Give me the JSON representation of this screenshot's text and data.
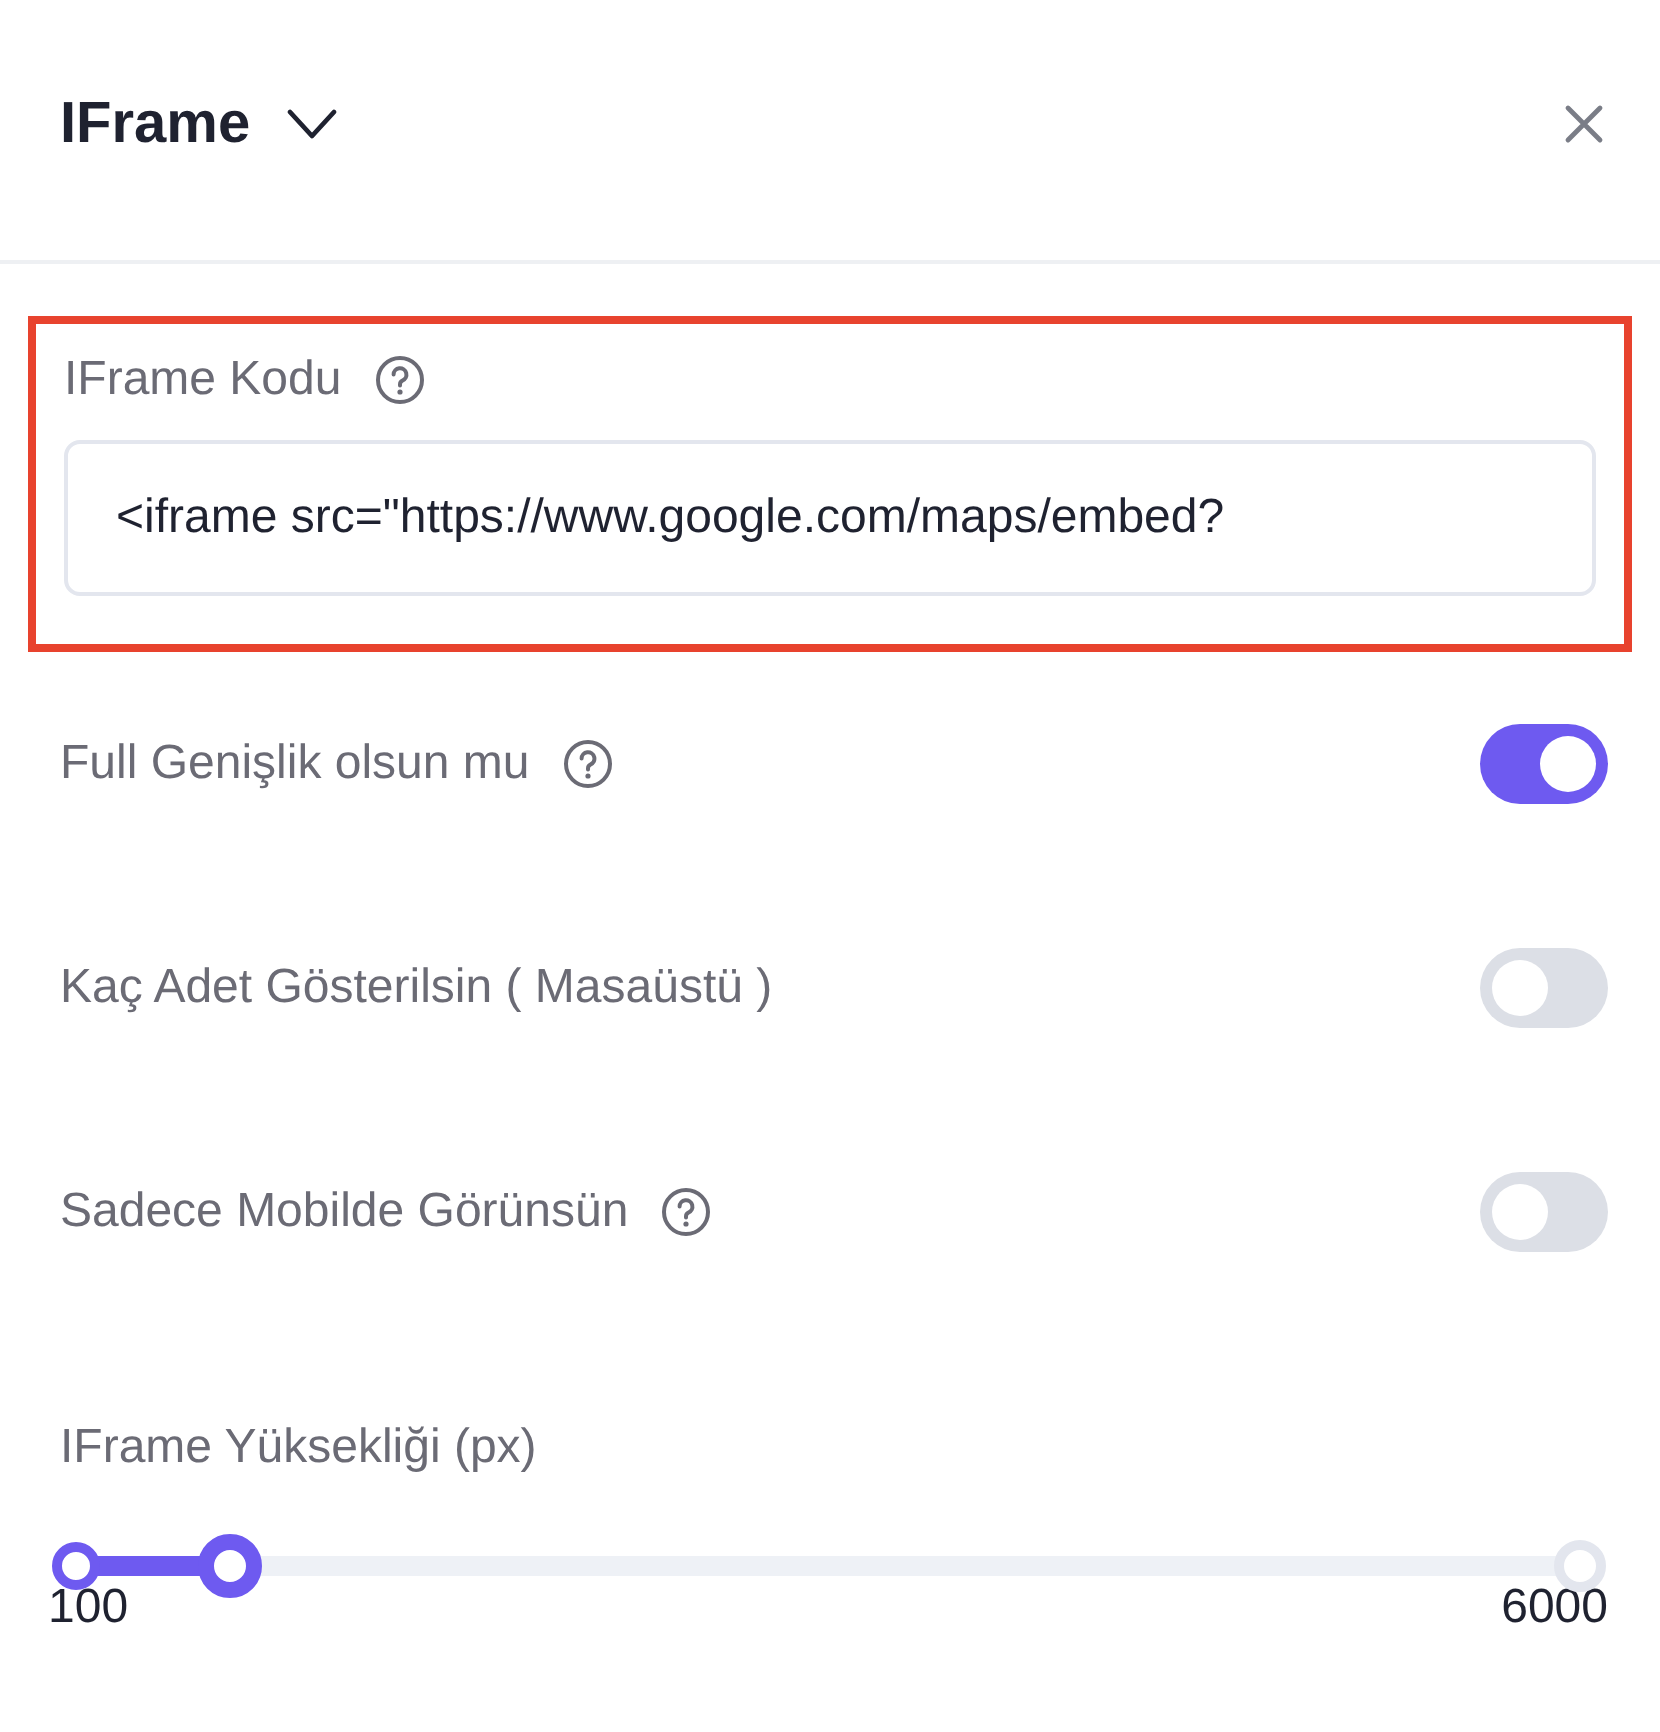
{
  "header": {
    "title": "IFrame",
    "expanded": false
  },
  "items": [
    {
      "kind": "code-field",
      "label": "IFrame Kodu",
      "help": true,
      "highlighted": true,
      "value": "<iframe src=\"https://www.google.com/maps/embed?"
    },
    {
      "kind": "toggle",
      "label": "Full Genişlik olsun mu",
      "help": true,
      "on": true
    },
    {
      "kind": "toggle",
      "label": "Kaç Adet Gösterilsin ( Masaüstü )",
      "help": false,
      "on": false
    },
    {
      "kind": "toggle",
      "label": "Sadece Mobilde Görünsün",
      "help": true,
      "on": false
    },
    {
      "kind": "range",
      "label": "IFrame Yüksekliği (px)",
      "help": false,
      "level": 0.103,
      "min": "100",
      "max": "6000"
    }
  ]
}
